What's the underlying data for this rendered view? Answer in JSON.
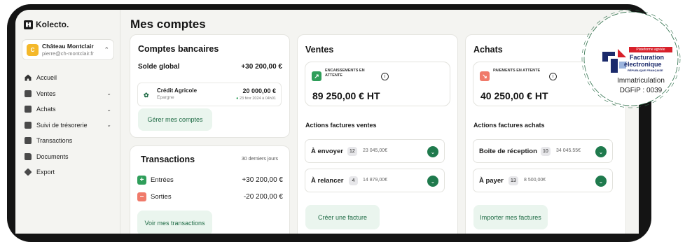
{
  "app": {
    "brand": "Kolecto."
  },
  "account": {
    "avatar_letter": "C",
    "name": "Château Montclair",
    "email": "pierre@ch-montclair.fr"
  },
  "nav": [
    {
      "label": "Accueil",
      "icon": "home-icon",
      "chevron": ""
    },
    {
      "label": "Ventes",
      "icon": "sales-icon",
      "chevron": "⌄"
    },
    {
      "label": "Achats",
      "icon": "purchases-icon",
      "chevron": "⌄"
    },
    {
      "label": "Suivi de trésorerie",
      "icon": "treasury-icon",
      "chevron": "⌄"
    },
    {
      "label": "Transactions",
      "icon": "transactions-icon",
      "chevron": ""
    },
    {
      "label": "Documents",
      "icon": "folder-icon",
      "chevron": ""
    },
    {
      "label": "Export",
      "icon": "export-icon",
      "chevron": ""
    }
  ],
  "main": {
    "title": "Mes comptes"
  },
  "comptes": {
    "title": "Comptes bancaires",
    "solde_label": "Solde global",
    "solde_value": "+30 200,00 €",
    "bank": {
      "name": "Crédit Agricole",
      "type": "Epargne",
      "amount": "20 000,00 €",
      "date": "23 févr 2024 à 04h01"
    },
    "button": "Gérer mes comptes"
  },
  "transactions": {
    "title": "Transactions",
    "period": "30 derniers jours",
    "entrees_label": "Entrées",
    "entrees_value": "+30 200,00 €",
    "sorties_label": "Sorties",
    "sorties_value": "-20 200,00 €",
    "button": "Voir mes transactions"
  },
  "ventes": {
    "title": "Ventes",
    "stat_label": "Encaissements en attente",
    "stat_value": "89 250,00 € HT",
    "actions_title": "Actions factures ventes",
    "actions": [
      {
        "label": "À envoyer",
        "count": "12",
        "amount": "23 045,00€"
      },
      {
        "label": "À relancer",
        "count": "4",
        "amount": "14 879,00€"
      }
    ],
    "button": "Créer une facture"
  },
  "achats": {
    "title": "Achats",
    "stat_label": "Paiements en attente",
    "stat_value": "40 250,00 € HT",
    "actions_title": "Actions factures achats",
    "actions": [
      {
        "label": "Boite de réception",
        "count": "10",
        "amount": "34 045.55€"
      },
      {
        "label": "À payer",
        "count": "13",
        "amount": "8 500,00€"
      }
    ],
    "button": "Importer mes factures"
  },
  "badge": {
    "tag": "Plateforme agréée",
    "line1": "Facturation",
    "line2": "électronique",
    "line3": "RÉPUBLIQUE FRANÇAISE",
    "line4": "Immatriculation",
    "line5": "DGFiP : 0039"
  },
  "colors": {
    "accent_green": "#1f7a4d",
    "button_bg": "#eaf5ee",
    "entrees": "#2f9e5a",
    "sorties": "#f07a6a",
    "ventes_icon": "#2f9e5a",
    "achats_icon": "#f07a6a"
  }
}
